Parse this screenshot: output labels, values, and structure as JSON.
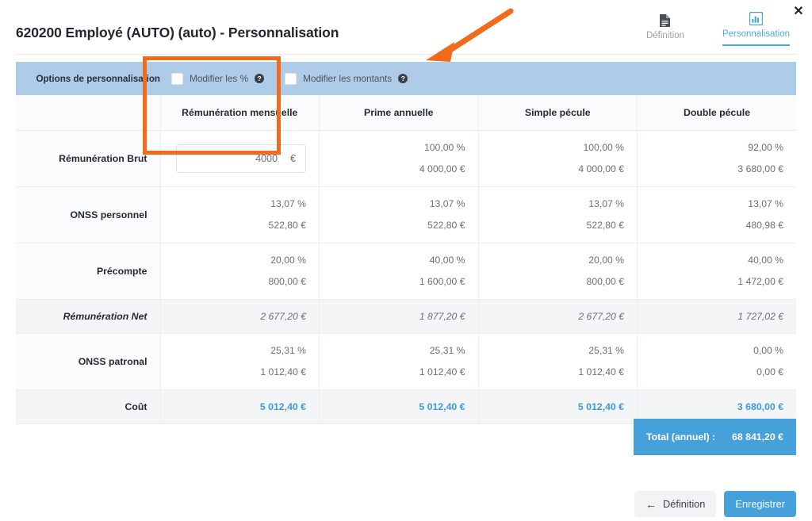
{
  "window": {
    "close_label": "✕",
    "title": "620200 Employé (AUTO) (auto) - Personnalisation"
  },
  "tabs": [
    {
      "label": "Définition",
      "icon": "document-icon",
      "active": false
    },
    {
      "label": "Personnalisation",
      "icon": "bar-chart-icon",
      "active": true
    }
  ],
  "options_bar": {
    "label": "Options de personnalisation",
    "items": [
      {
        "label": "Modifier les %",
        "checked": false,
        "help": "?"
      },
      {
        "label": "Modifier les montants",
        "checked": false,
        "help": "?"
      }
    ]
  },
  "table": {
    "columns": [
      "",
      "Rémunération mensuelle",
      "Prime annuelle",
      "Simple pécule",
      "Double pécule"
    ],
    "rows": [
      {
        "label": "Rémunération Brut",
        "type": "input_first",
        "input": {
          "value": "4000",
          "currency": "€"
        },
        "cells": [
          {
            "pct": "100,00 %",
            "amt": "4 000,00 €"
          },
          {
            "pct": "100,00 %",
            "amt": "4 000,00 €"
          },
          {
            "pct": "92,00 %",
            "amt": "3 680,00 €"
          }
        ]
      },
      {
        "label": "ONSS personnel",
        "type": "pair",
        "cells": [
          {
            "pct": "13,07 %",
            "amt": "522,80 €"
          },
          {
            "pct": "13,07 %",
            "amt": "522,80 €"
          },
          {
            "pct": "13,07 %",
            "amt": "522,80 €"
          },
          {
            "pct": "13,07 %",
            "amt": "480,98 €"
          }
        ]
      },
      {
        "label": "Précompte",
        "type": "pair",
        "cells": [
          {
            "pct": "20,00 %",
            "amt": "800,00 €"
          },
          {
            "pct": "40,00 %",
            "amt": "1 600,00 €"
          },
          {
            "pct": "20,00 %",
            "amt": "800,00 €"
          },
          {
            "pct": "40,00 %",
            "amt": "1 472,00 €"
          }
        ]
      },
      {
        "label": "Rémunération Net",
        "type": "net",
        "cells": [
          {
            "amt": "2 677,20 €"
          },
          {
            "amt": "1 877,20 €"
          },
          {
            "amt": "2 677,20 €"
          },
          {
            "amt": "1 727,02 €"
          }
        ]
      },
      {
        "label": "ONSS patronal",
        "type": "pair",
        "cells": [
          {
            "pct": "25,31 %",
            "amt": "1 012,40 €"
          },
          {
            "pct": "25,31 %",
            "amt": "1 012,40 €"
          },
          {
            "pct": "25,31 %",
            "amt": "1 012,40 €"
          },
          {
            "pct": "0,00 %",
            "amt": "0,00 €"
          }
        ]
      },
      {
        "label": "Coût",
        "type": "cost",
        "cells": [
          {
            "amt": "5 012,40 €"
          },
          {
            "amt": "5 012,40 €"
          },
          {
            "amt": "5 012,40 €"
          },
          {
            "amt": "3 680,00 €"
          }
        ]
      }
    ]
  },
  "total": {
    "label": "Total (annuel) :",
    "value": "68 841,20 €"
  },
  "footer": {
    "back_label": "Définition",
    "back_arrow": "←",
    "save_label": "Enregistrer"
  },
  "colors": {
    "accent_blue": "#46a0da",
    "options_band": "#aecbe8",
    "annotation_orange": "#f26a1b",
    "cost_text": "#3b9ae1"
  }
}
